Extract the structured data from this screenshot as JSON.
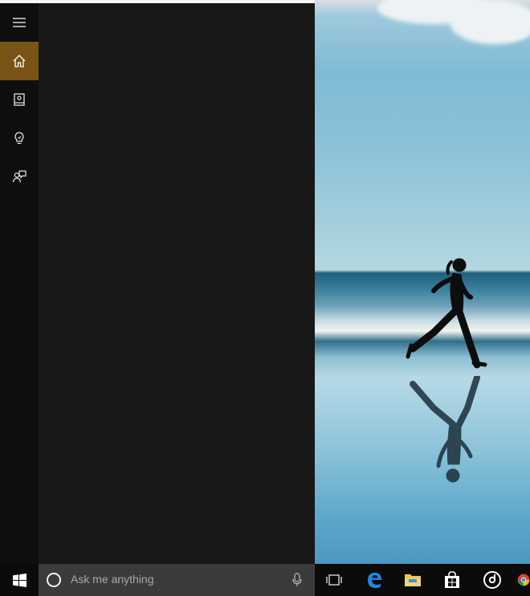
{
  "taskbar": {
    "search": {
      "placeholder": "Ask me anything"
    },
    "pinned": [
      {
        "name": "task-view-icon"
      },
      {
        "name": "edge-icon"
      },
      {
        "name": "file-explorer-icon"
      },
      {
        "name": "store-icon"
      },
      {
        "name": "groove-music-icon"
      },
      {
        "name": "chrome-icon"
      }
    ]
  },
  "cortana": {
    "rail": [
      {
        "name": "hamburger-menu-icon"
      },
      {
        "name": "home-icon",
        "active": true
      },
      {
        "name": "notebook-icon"
      },
      {
        "name": "reminders-icon"
      },
      {
        "name": "feedback-icon"
      }
    ]
  },
  "colors": {
    "accent": "#7a5316",
    "panel": "#181818",
    "rail": "#0e0e0e",
    "taskbar": "#0b0b0b",
    "search_box": "#3b3b3b"
  }
}
